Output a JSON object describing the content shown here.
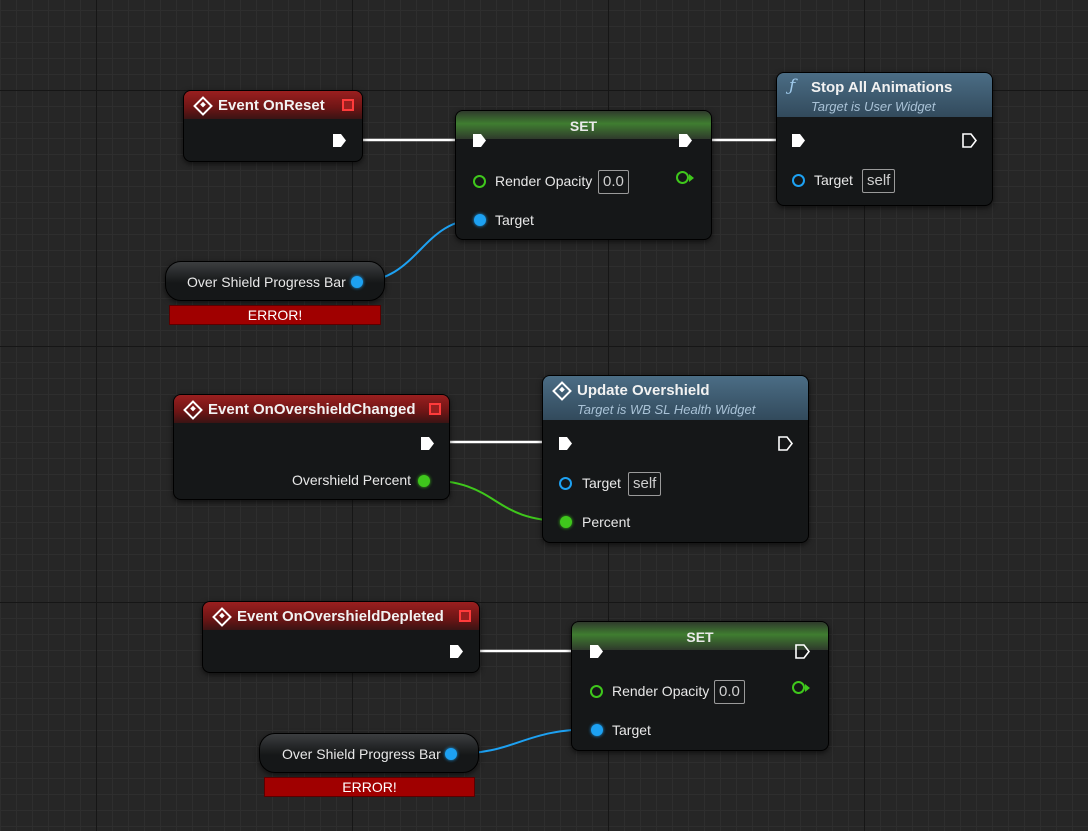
{
  "graph": {
    "event_on_reset": {
      "title": "Event OnReset"
    },
    "set_1": {
      "title": "SET",
      "render_opacity_label": "Render Opacity",
      "render_opacity_value": "0.0",
      "target_label": "Target"
    },
    "stop_all_animations": {
      "title": "Stop All Animations",
      "subtitle": "Target is User Widget",
      "target_label": "Target",
      "target_value": "self"
    },
    "getter_1": {
      "label": "Over Shield Progress Bar",
      "error": "ERROR!"
    },
    "event_on_overshield_changed": {
      "title": "Event OnOvershieldChanged",
      "output_label": "Overshield Percent"
    },
    "update_overshield": {
      "title": "Update Overshield",
      "subtitle": "Target is WB SL Health Widget",
      "target_label": "Target",
      "target_value": "self",
      "percent_label": "Percent"
    },
    "event_on_overshield_depleted": {
      "title": "Event OnOvershieldDepleted"
    },
    "set_2": {
      "title": "SET",
      "render_opacity_label": "Render Opacity",
      "render_opacity_value": "0.0",
      "target_label": "Target"
    },
    "getter_2": {
      "label": "Over Shield Progress Bar",
      "error": "ERROR!"
    }
  },
  "colors": {
    "exec": "#ffffff",
    "object_pin": "#1da1f2",
    "float_pin": "#3fc71c",
    "event_header": "#9a1f1f",
    "function_header": "#4b6d85",
    "error": "#a00000"
  }
}
